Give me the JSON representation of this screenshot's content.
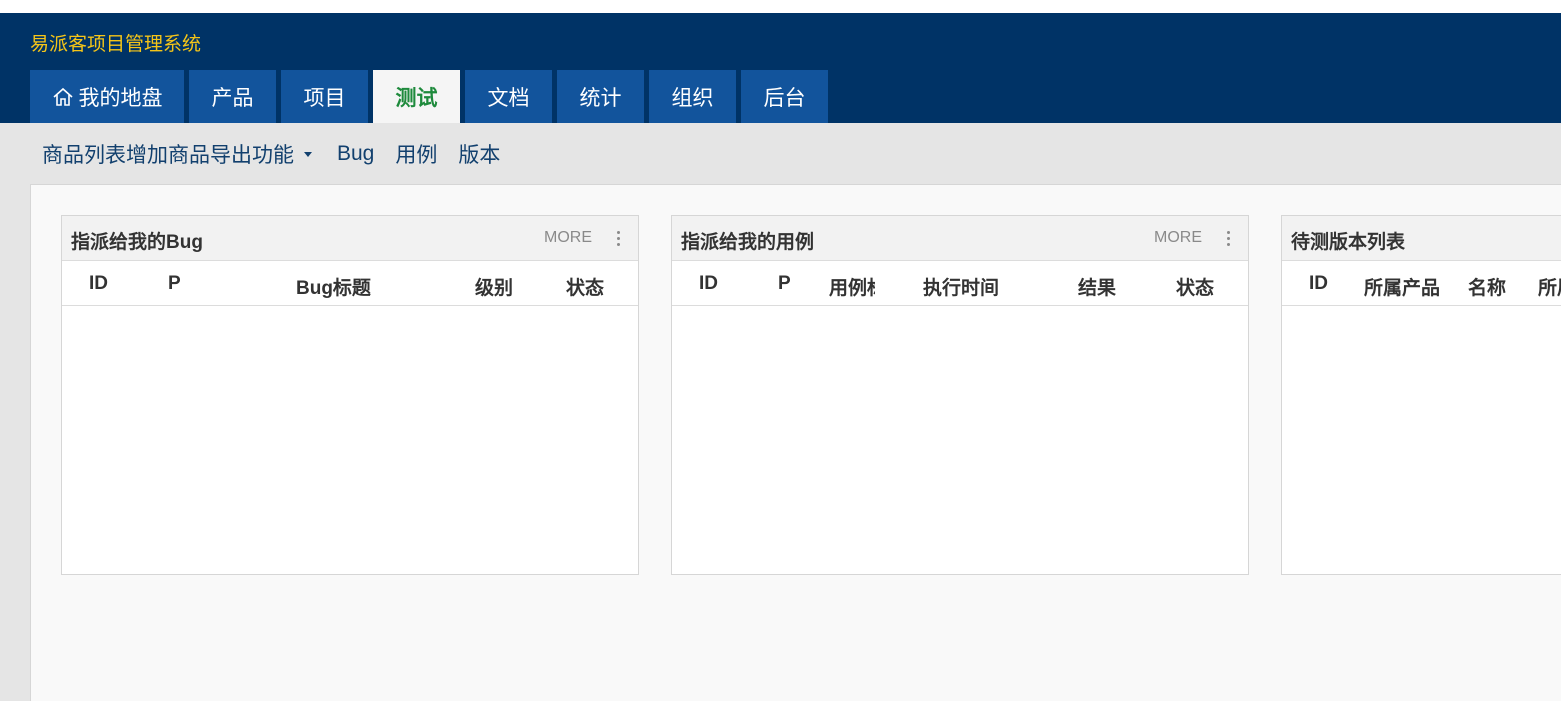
{
  "app": {
    "title": "易派客项目管理系统"
  },
  "nav": {
    "tabs": [
      {
        "label": "我的地盘",
        "icon": "home-icon"
      },
      {
        "label": "产品"
      },
      {
        "label": "项目"
      },
      {
        "label": "测试"
      },
      {
        "label": "文档"
      },
      {
        "label": "统计"
      },
      {
        "label": "组织"
      },
      {
        "label": "后台"
      }
    ],
    "active": "测试"
  },
  "subnav": {
    "dropdown_label": "商品列表增加商品导出功能",
    "items": [
      {
        "label": "Bug"
      },
      {
        "label": "用例"
      },
      {
        "label": "版本"
      }
    ]
  },
  "panels": [
    {
      "title": "指派给我的Bug",
      "more_label": "MORE",
      "columns": [
        "ID",
        "P",
        "Bug标题",
        "级别",
        "状态"
      ]
    },
    {
      "title": "指派给我的用例",
      "more_label": "MORE",
      "columns": [
        "ID",
        "P",
        "用例标题",
        "执行时间",
        "结果",
        "状态"
      ]
    },
    {
      "title": "待测版本列表",
      "columns": [
        "ID",
        "所属产品",
        "名称",
        "所属项目"
      ]
    }
  ],
  "colors": {
    "header_bg": "#003366",
    "tab_bg": "#12549c",
    "title_color": "#f5c518",
    "active_tab_text": "#1e8a3c"
  }
}
